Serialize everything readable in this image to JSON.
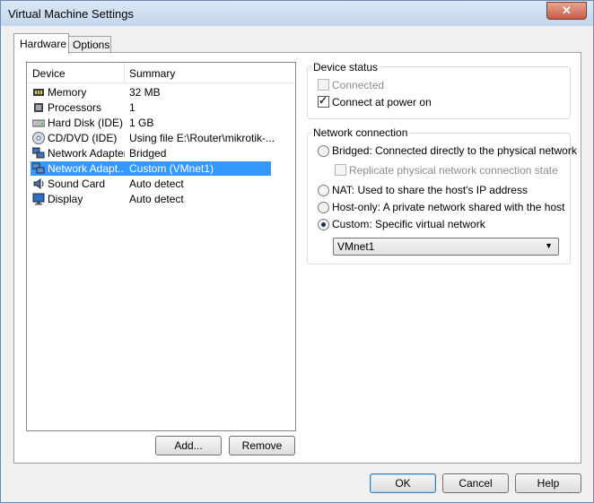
{
  "window": {
    "title": "Virtual Machine Settings",
    "close_glyph": "✕"
  },
  "tabs": [
    {
      "label": "Hardware"
    },
    {
      "label": "Options"
    }
  ],
  "device_list": {
    "columns": {
      "device": "Device",
      "summary": "Summary"
    },
    "rows": [
      {
        "device": "Memory",
        "summary": "32 MB",
        "icon": "memory-icon"
      },
      {
        "device": "Processors",
        "summary": "1",
        "icon": "processor-icon"
      },
      {
        "device": "Hard Disk (IDE)",
        "summary": "1 GB",
        "icon": "hard-disk-icon"
      },
      {
        "device": "CD/DVD (IDE)",
        "summary": "Using file E:\\Router\\mikrotik-...",
        "icon": "cd-dvd-icon"
      },
      {
        "device": "Network Adapter",
        "summary": "Bridged",
        "icon": "network-adapter-icon"
      },
      {
        "device": "Network Adapt...",
        "summary": "Custom (VMnet1)",
        "icon": "network-adapter-icon",
        "selected": true
      },
      {
        "device": "Sound Card",
        "summary": "Auto detect",
        "icon": "sound-card-icon"
      },
      {
        "device": "Display",
        "summary": "Auto detect",
        "icon": "display-icon"
      }
    ]
  },
  "list_buttons": {
    "add": "Add...",
    "remove": "Remove"
  },
  "device_status": {
    "title": "Device status",
    "connected": {
      "label": "Connected",
      "checked": false,
      "disabled": true
    },
    "connect_at_power_on": {
      "label": "Connect at power on",
      "checked": true
    }
  },
  "network_connection": {
    "title": "Network connection",
    "bridged": {
      "label": "Bridged: Connected directly to the physical network",
      "selected": false
    },
    "replicate": {
      "label": "Replicate physical network connection state",
      "checked": false,
      "disabled": true
    },
    "nat": {
      "label": "NAT: Used to share the host's IP address",
      "selected": false
    },
    "host_only": {
      "label": "Host-only: A private network shared with the host",
      "selected": false
    },
    "custom": {
      "label": "Custom: Specific virtual network",
      "selected": true
    },
    "vmnet_select": {
      "value": "VMnet1"
    }
  },
  "footer_buttons": {
    "ok": "OK",
    "cancel": "Cancel",
    "help": "Help"
  },
  "colors": {
    "selection": "#3399ff",
    "titlebar": "#c3d6ec",
    "close": "#c75c46"
  }
}
